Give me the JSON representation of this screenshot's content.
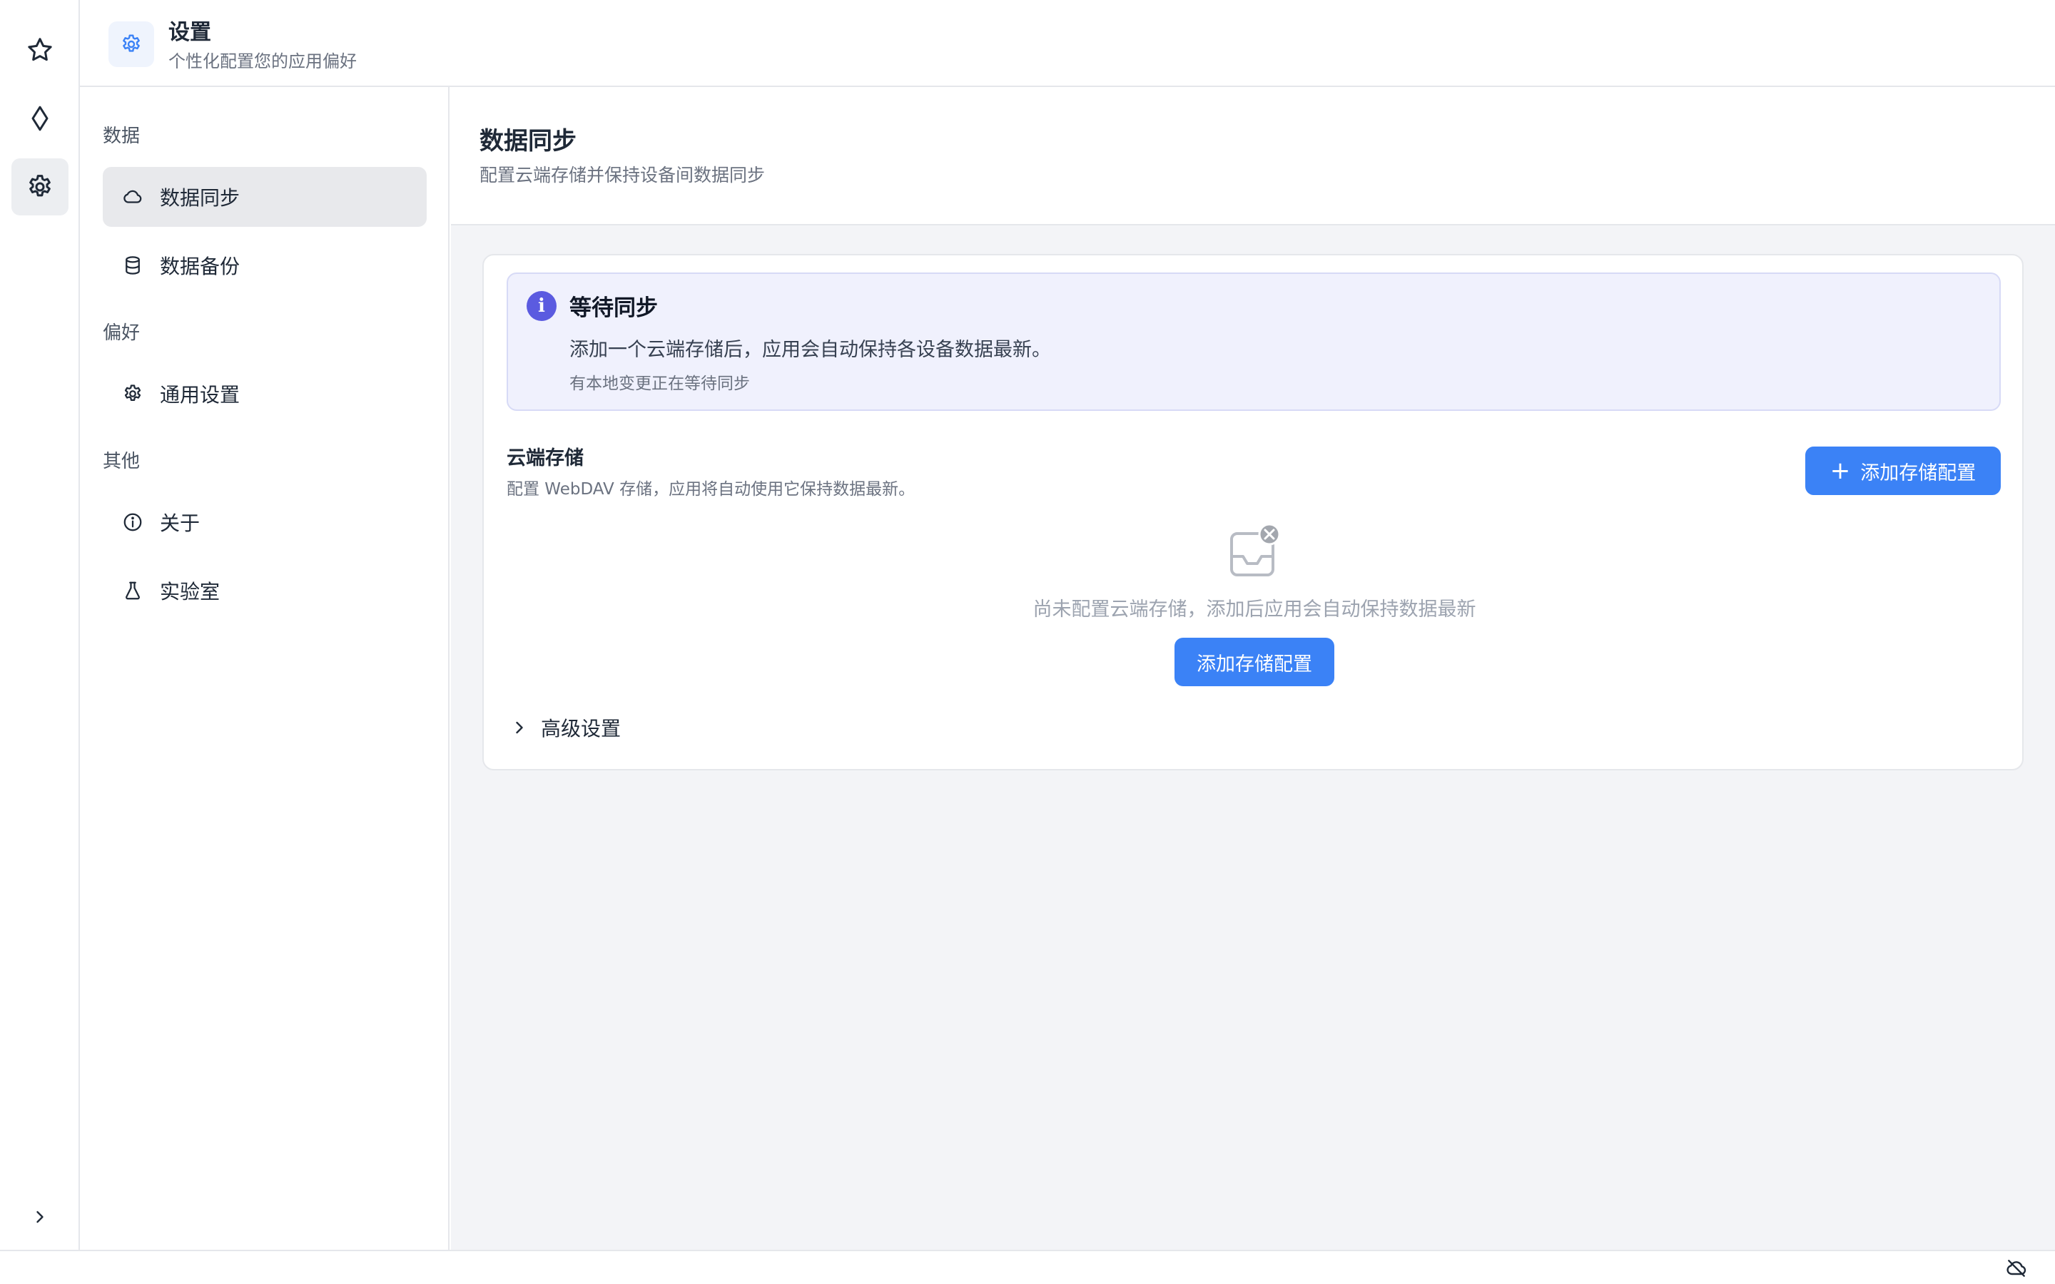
{
  "header": {
    "title": "设置",
    "subtitle": "个性化配置您的应用偏好",
    "icon": "gear-icon"
  },
  "rail": {
    "items": [
      {
        "icon": "star-icon",
        "active": false
      },
      {
        "icon": "diamond-icon",
        "active": false
      },
      {
        "icon": "gear-icon",
        "active": true
      }
    ],
    "collapse_icon": "chevron-right-icon"
  },
  "nav": {
    "sections": [
      {
        "label": "数据",
        "items": [
          {
            "label": "数据同步",
            "icon": "cloud-icon",
            "active": true
          },
          {
            "label": "数据备份",
            "icon": "database-icon",
            "active": false
          }
        ]
      },
      {
        "label": "偏好",
        "items": [
          {
            "label": "通用设置",
            "icon": "gear-icon",
            "active": false
          }
        ]
      },
      {
        "label": "其他",
        "items": [
          {
            "label": "关于",
            "icon": "info-icon",
            "active": false
          },
          {
            "label": "实验室",
            "icon": "flask-icon",
            "active": false
          }
        ]
      }
    ]
  },
  "main": {
    "title": "数据同步",
    "subtitle": "配置云端存储并保持设备间数据同步",
    "alert": {
      "title": "等待同步",
      "message": "添加一个云端存储后，应用会自动保持各设备数据最新。",
      "note": "有本地变更正在等待同步"
    },
    "storage": {
      "title": "云端存储",
      "description": "配置 WebDAV 存储，应用将自动使用它保持数据最新。",
      "add_button_label": "添加存储配置",
      "empty_text": "尚未配置云端存储，添加后应用会自动保持数据最新",
      "empty_button_label": "添加存储配置"
    },
    "advanced_label": "高级设置"
  },
  "statusbar": {
    "icon": "cloud-off-icon"
  },
  "colors": {
    "accent": "#3b82f6",
    "info": "#5b5be0",
    "active_bg": "#e8e9ec"
  }
}
